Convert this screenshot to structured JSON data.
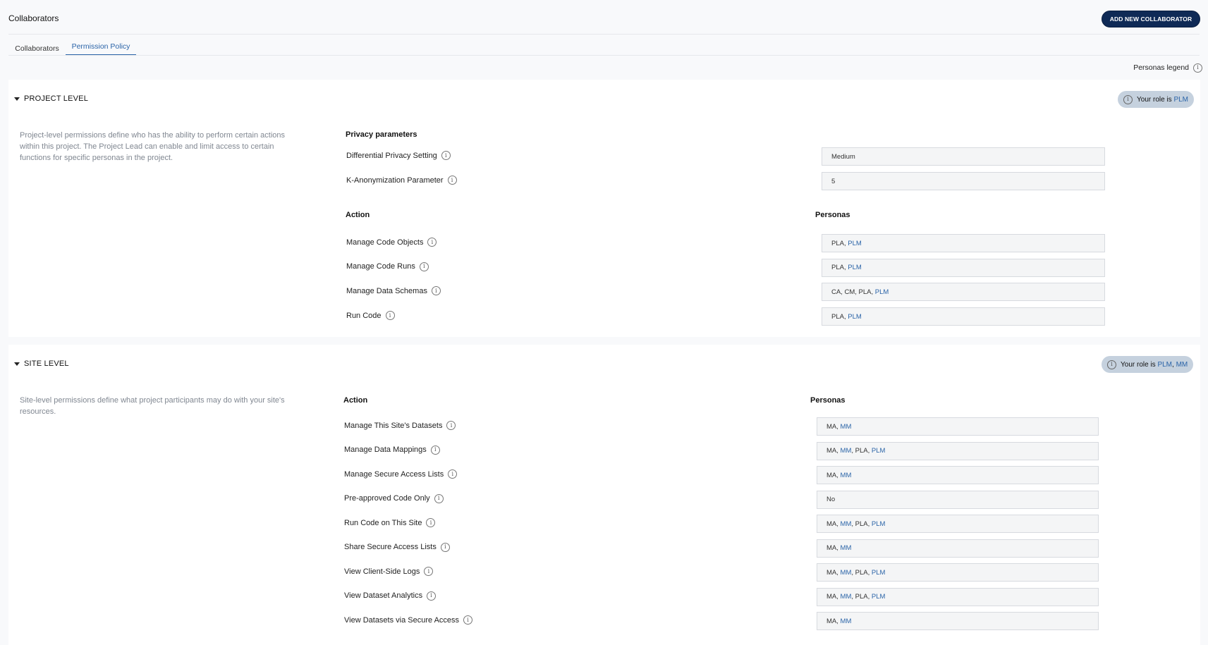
{
  "header": {
    "title": "Collaborators",
    "add_button": "ADD NEW COLLABORATOR"
  },
  "tabs": [
    {
      "label": "Collaborators",
      "active": false
    },
    {
      "label": "Permission Policy",
      "active": true
    }
  ],
  "legend": {
    "label": "Personas legend"
  },
  "icons": {
    "info": "info-circle-icon",
    "caret": "caret-down-icon"
  },
  "colors": {
    "accent": "#2b64a8",
    "primary_button": "#0f2a56",
    "role_pill": "#c5d1de"
  },
  "project": {
    "title": "PROJECT LEVEL",
    "role_prefix": "Your role is ",
    "role_values": [
      "PLM"
    ],
    "description": "Project-level permissions define who has the ability to perform certain actions within this project. The Project Lead can enable and limit access to certain functions for specific personas in the project.",
    "privacy_heading": "Privacy parameters",
    "privacy": [
      {
        "label": "Differential Privacy Setting",
        "value": "Medium"
      },
      {
        "label": "K-Anonymization Parameter",
        "value": "5"
      }
    ],
    "action_heading": "Action",
    "personas_heading": "Personas",
    "actions": [
      {
        "label": "Manage Code Objects",
        "personas": [
          "PLA",
          "PLM"
        ]
      },
      {
        "label": "Manage Code Runs",
        "personas": [
          "PLA",
          "PLM"
        ]
      },
      {
        "label": "Manage Data Schemas",
        "personas": [
          "CA",
          "CM",
          "PLA",
          "PLM"
        ]
      },
      {
        "label": "Run Code",
        "personas": [
          "PLA",
          "PLM"
        ]
      }
    ]
  },
  "site": {
    "title": "SITE LEVEL",
    "role_prefix": "Your role is ",
    "role_values": [
      "PLM",
      "MM"
    ],
    "description": "Site-level permissions define what project participants may do with your site's resources.",
    "action_heading": "Action",
    "personas_heading": "Personas",
    "actions": [
      {
        "label": "Manage This Site's Datasets",
        "personas": [
          "MA",
          "MM"
        ]
      },
      {
        "label": "Manage Data Mappings",
        "personas": [
          "MA",
          "MM",
          "PLA",
          "PLM"
        ]
      },
      {
        "label": "Manage Secure Access Lists",
        "personas": [
          "MA",
          "MM"
        ]
      },
      {
        "label": "Pre-approved Code Only",
        "personas": [
          "No"
        ]
      },
      {
        "label": "Run Code on This Site",
        "personas": [
          "MA",
          "MM",
          "PLA",
          "PLM"
        ]
      },
      {
        "label": "Share Secure Access Lists",
        "personas": [
          "MA",
          "MM"
        ]
      },
      {
        "label": "View Client-Side Logs",
        "personas": [
          "MA",
          "MM",
          "PLA",
          "PLM"
        ]
      },
      {
        "label": "View Dataset Analytics",
        "personas": [
          "MA",
          "MM",
          "PLA",
          "PLM"
        ]
      },
      {
        "label": "View Datasets via Secure Access",
        "personas": [
          "MA",
          "MM"
        ]
      }
    ]
  }
}
